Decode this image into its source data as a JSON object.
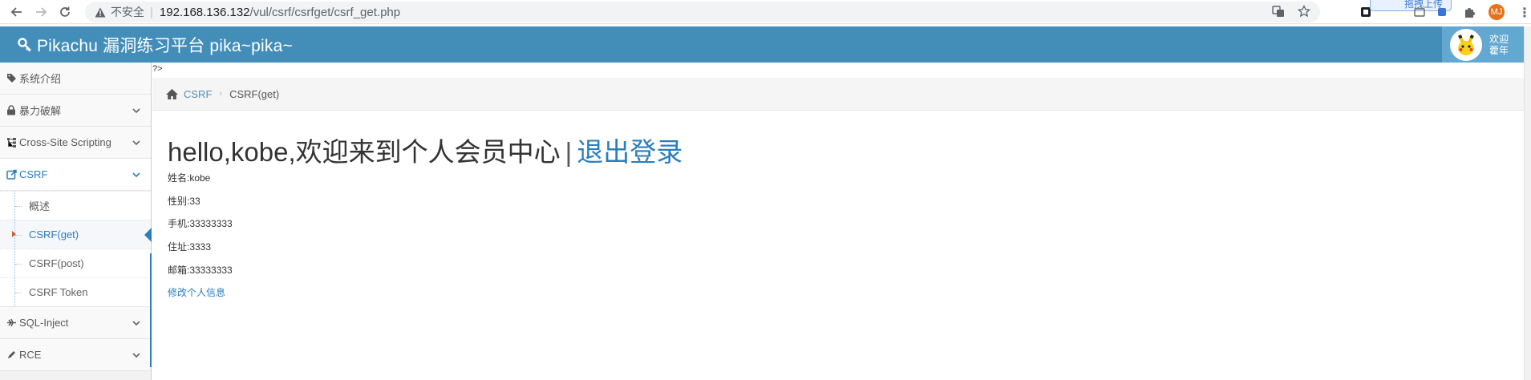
{
  "browser": {
    "insecure_label": "不安全",
    "url_host": "192.168.136.132",
    "url_path": "/vul/csrf/csrfget/csrf_get.php",
    "upload_pill": "拖拽上传",
    "profile_initials": "MJ"
  },
  "header": {
    "title": "Pikachu 漏洞练习平台 pika~pika~",
    "welcome_line1": "欢迎",
    "welcome_line2": "藿年"
  },
  "sidebar": {
    "items": [
      {
        "label": "系统介绍",
        "icon": "tag-icon"
      },
      {
        "label": "暴力破解",
        "icon": "lock-icon"
      },
      {
        "label": "Cross-Site Scripting",
        "icon": "sitemap-icon"
      },
      {
        "label": "CSRF",
        "icon": "share-icon"
      },
      {
        "label": "SQL-Inject",
        "icon": "fighter-jet-icon"
      },
      {
        "label": "RCE",
        "icon": "pencil-icon"
      }
    ],
    "csrf_sub": [
      "概述",
      "CSRF(get)",
      "CSRF(post)",
      "CSRF Token"
    ]
  },
  "page": {
    "php_artifact": "?>",
    "breadcrumb_link": "CSRF",
    "breadcrumb_current": "CSRF(get)",
    "title_main": "hello,kobe,欢迎来到个人会员中心",
    "title_sep": "|",
    "logout": "退出登录",
    "info": [
      "姓名:kobe",
      "性别:33",
      "手机:33333333",
      "住址:3333",
      "邮箱:33333333"
    ],
    "edit_link": "修改个人信息"
  }
}
